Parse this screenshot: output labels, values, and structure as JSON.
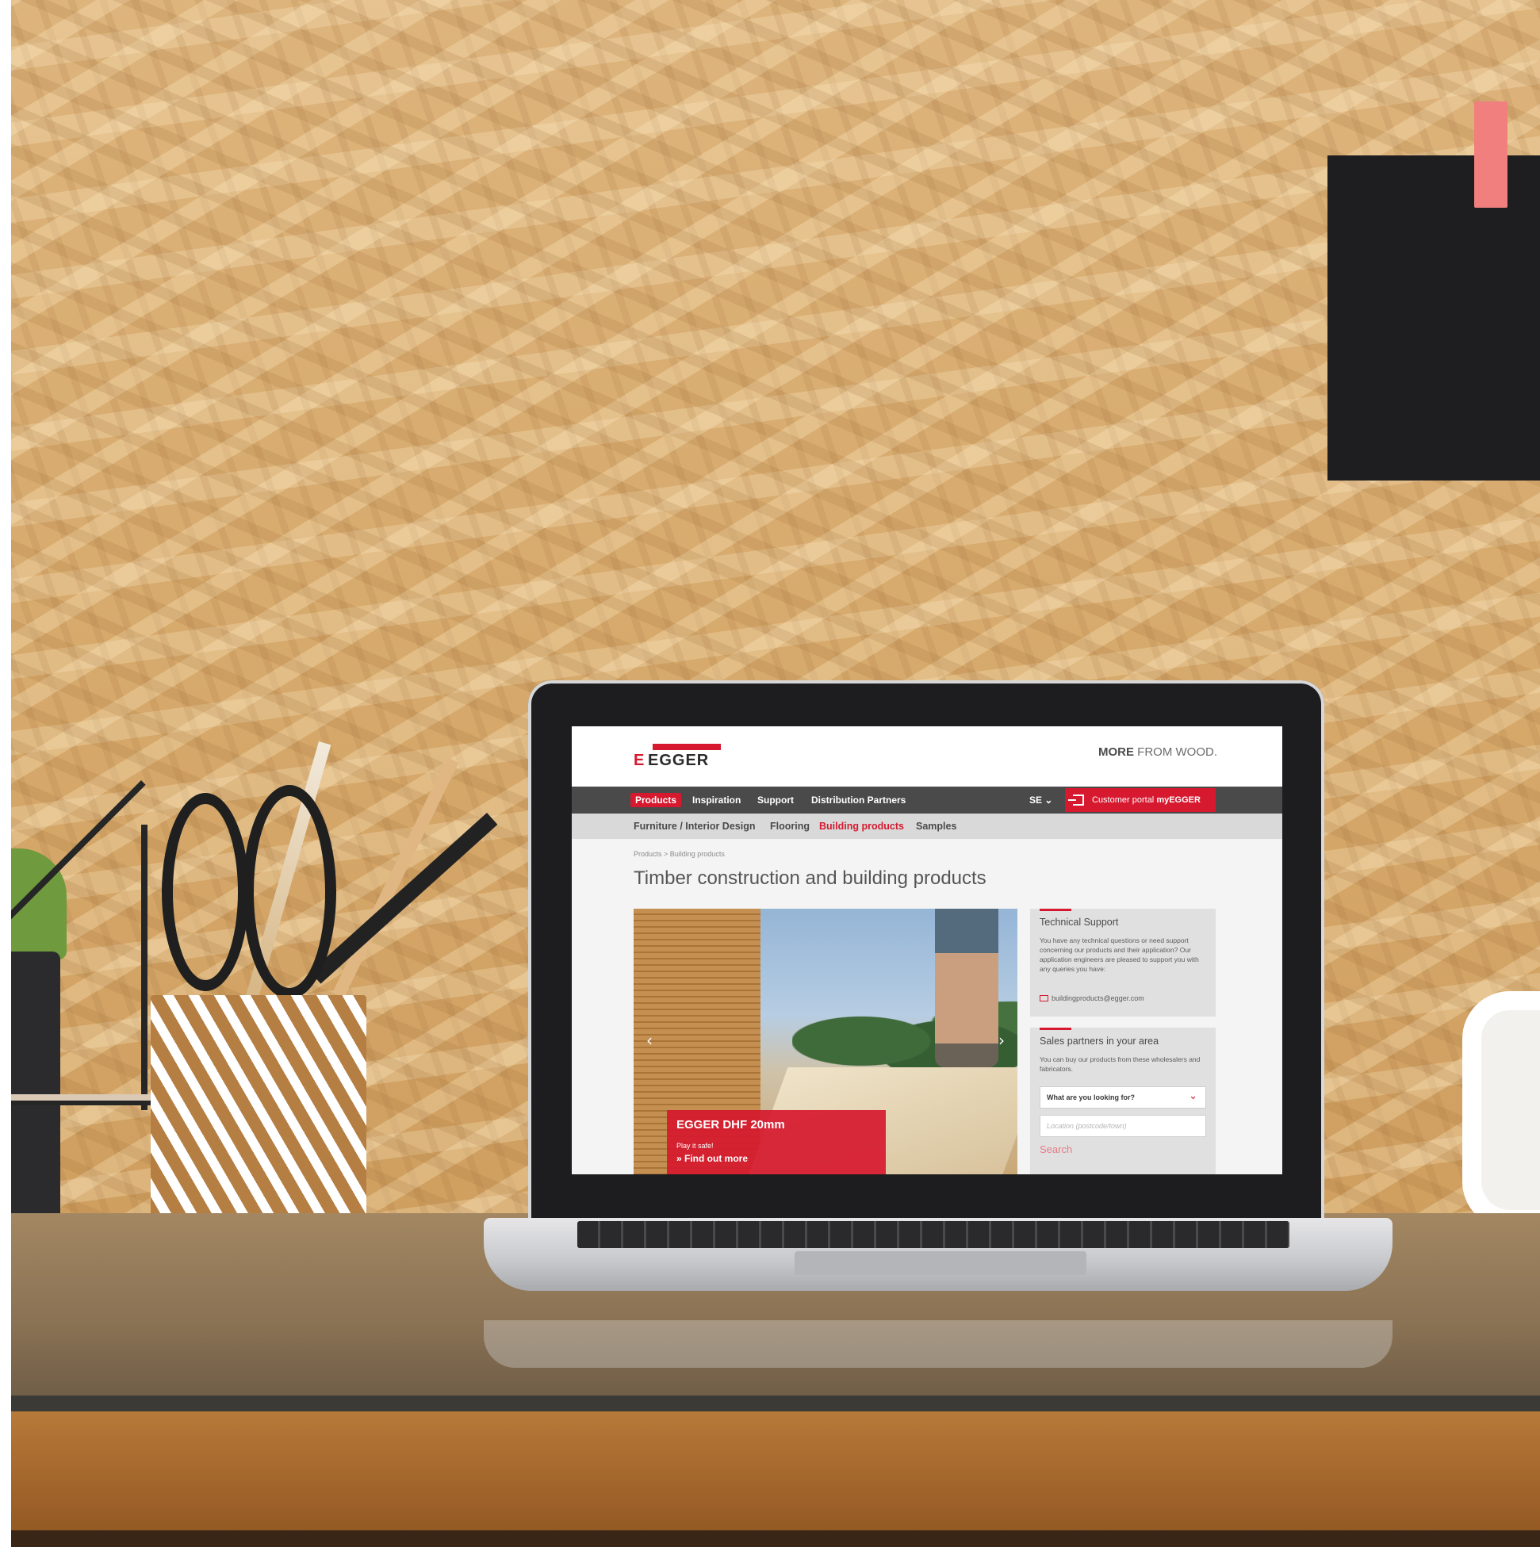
{
  "site": {
    "logo": {
      "mark": "E",
      "word": "EGGER"
    },
    "tagline": {
      "bold": "MORE",
      "rest": " FROM WOOD."
    },
    "nav": [
      {
        "label": "Products",
        "active": true
      },
      {
        "label": "Inspiration",
        "active": false
      },
      {
        "label": "Support",
        "active": false
      },
      {
        "label": "Distribution Partners",
        "active": false
      }
    ],
    "language": "SE ⌄",
    "portal": {
      "text": "Customer portal ",
      "bold": "myEGGER",
      "icon": "login-icon"
    },
    "subnav": [
      {
        "label": "Furniture / Interior Design",
        "active": false
      },
      {
        "label": "Flooring",
        "active": false
      },
      {
        "label": "Building products",
        "active": true
      },
      {
        "label": "Samples",
        "active": false
      }
    ],
    "breadcrumb": "Products  >  Building products",
    "page_title": "Timber construction and building products",
    "hero": {
      "prev_icon": "chevron-left-icon",
      "next_icon": "chevron-right-icon",
      "prev_glyph": "‹",
      "next_glyph": "›",
      "teaser_title": "EGGER DHF 20mm",
      "teaser_sub": "Play it safe!",
      "teaser_link": "» Find out more"
    },
    "technical_support": {
      "heading": "Technical Support",
      "text": "You have any technical questions or need support concerning our products and their application? Our application engineers are pleased to support you with any queries you have:",
      "email": "buildingproducts@egger.com",
      "email_icon": "mail-icon"
    },
    "sales_partners": {
      "heading": "Sales partners in your area",
      "text": "You can buy our products from these wholesalers and fabricators.",
      "select_value": "What are you looking for?",
      "select_icon": "chevron-down-icon",
      "chevron_glyph": "⌄",
      "location_placeholder": "Location (postcode/town)",
      "search_label": "Search"
    }
  },
  "colors": {
    "brand_red": "#d6192f",
    "nav_dark": "#4a4a4a",
    "subnav_grey": "#d9d9d9"
  }
}
